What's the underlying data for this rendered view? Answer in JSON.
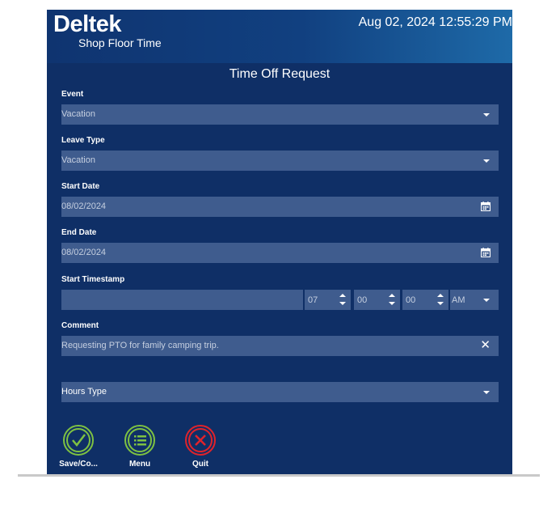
{
  "header": {
    "logo_main": "Deltek",
    "logo_sub": "Shop Floor Time",
    "datetime": "Aug 02, 2024 12:55:29 PM"
  },
  "form": {
    "title": "Time Off Request",
    "event": {
      "label": "Event",
      "value": "Vacation"
    },
    "leave_type": {
      "label": "Leave Type",
      "value": "Vacation"
    },
    "start_date": {
      "label": "Start Date",
      "value": "08/02/2024"
    },
    "end_date": {
      "label": "End Date",
      "value": "08/02/2024"
    },
    "start_timestamp": {
      "label": "Start Timestamp",
      "date_value": "",
      "hour": "07",
      "minute": "00",
      "second": "00",
      "ampm": "AM"
    },
    "comment": {
      "label": "Comment",
      "value": "Requesting PTO for family camping trip."
    },
    "hours_type": {
      "value": "Hours Type"
    }
  },
  "footer": {
    "save_label": "Save/Co...",
    "menu_label": "Menu",
    "quit_label": "Quit"
  },
  "icons": {
    "dropdown": "chevron-down-icon",
    "calendar": "calendar-icon",
    "clear": "close-icon",
    "save": "check-circle-icon",
    "menu": "list-circle-icon",
    "quit": "x-circle-icon"
  },
  "colors": {
    "background": "#0f2f66",
    "field": "#3f5c8e",
    "save_accent": "#7dc142",
    "menu_accent": "#7dc142",
    "quit_accent": "#e0232b"
  }
}
